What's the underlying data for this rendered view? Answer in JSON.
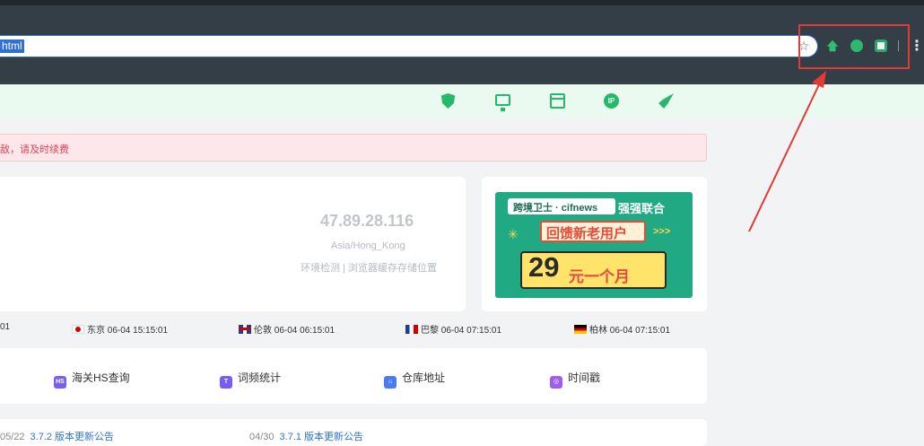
{
  "browser": {
    "url_selected": "html",
    "star_icon": "star-icon",
    "extensions": [
      "upload-cloud-icon",
      "leaf-icon",
      "translate-icon"
    ],
    "menu_icon": "more-vert-icon",
    "highlight_color": "#e53935"
  },
  "nav": {
    "icons": [
      "shield-icon",
      "monitor-icon",
      "browser-window-icon",
      "ip-icon",
      "rocket-icon"
    ],
    "accent": "#26b96a"
  },
  "alert": {
    "text": "敌，请及时续费"
  },
  "ip_card": {
    "ip": "47.89.28.116",
    "timezone": "Asia/Hong_Kong",
    "links": "环境检测 | 浏览器缓存存储位置"
  },
  "ad": {
    "brand": "跨境卫士 · cifnews",
    "slogan": "强强联合",
    "banner": "回馈新老用户",
    "price_num": "29",
    "price_text": "元一个月"
  },
  "times": [
    {
      "label": "01",
      "flag": ""
    },
    {
      "label": "东京 06-04 15:15:01",
      "flag": "jp"
    },
    {
      "label": "伦敦 06-04 06:15:01",
      "flag": "uk"
    },
    {
      "label": "巴黎 06-04 07:15:01",
      "flag": "fr"
    },
    {
      "label": "柏林 06-04 07:15:01",
      "flag": "de"
    }
  ],
  "tools": [
    {
      "label": "海关HS查询",
      "icon_text": "HS",
      "color": "#7b5cf0"
    },
    {
      "label": "词频统计",
      "icon_text": "T",
      "color": "#7b5cf0"
    },
    {
      "label": "仓库地址",
      "icon_text": "⌂",
      "color": "#4a7cf0"
    },
    {
      "label": "时间戳",
      "icon_text": "◎",
      "color": "#a35cf0"
    }
  ],
  "news": [
    {
      "date": "05/22",
      "title": "3.7.2 版本更新公告"
    },
    {
      "date": "04/30",
      "title": "3.7.1 版本更新公告"
    }
  ]
}
